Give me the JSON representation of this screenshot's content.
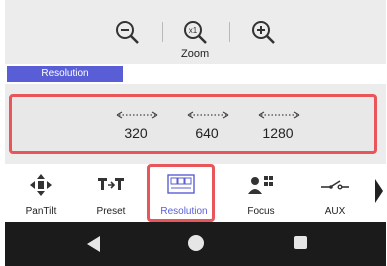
{
  "zoom": {
    "label": "Zoom",
    "buttons": [
      {
        "icon": "zoom-out-icon"
      },
      {
        "icon": "zoom-1x-icon",
        "text": "x1"
      },
      {
        "icon": "zoom-in-icon"
      }
    ]
  },
  "tab": {
    "label": "Resolution",
    "color": "#5a5ed6"
  },
  "resolution": {
    "highlight_color": "#e8555a",
    "options": [
      "320",
      "640",
      "1280"
    ]
  },
  "nav": {
    "items": [
      {
        "label": "PanTilt",
        "icon": "pan-tilt-icon"
      },
      {
        "label": "Preset",
        "icon": "preset-icon"
      },
      {
        "label": "Resolution",
        "icon": "resolution-icon",
        "active": true
      },
      {
        "label": "Focus",
        "icon": "focus-icon"
      },
      {
        "label": "AUX",
        "icon": "aux-switch-icon"
      }
    ],
    "more_icon": "chevron-right-icon"
  },
  "system": {
    "buttons": [
      "back-icon",
      "home-icon",
      "recent-apps-icon"
    ]
  }
}
